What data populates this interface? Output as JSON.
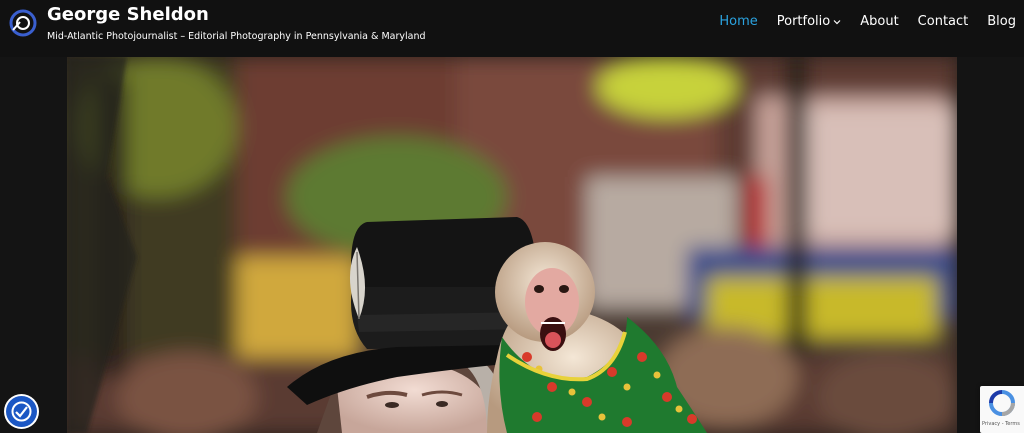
{
  "header": {
    "site_title": "George Sheldon",
    "tagline": "Mid-Atlantic Photojournalist – Editorial Photography in Pennsylvania & Maryland",
    "logo_icon": "camera-swirl-logo-icon"
  },
  "nav": {
    "items": [
      {
        "label": "Home",
        "active": true
      },
      {
        "label": "Portfolio",
        "has_dropdown": true
      },
      {
        "label": "About"
      },
      {
        "label": "Contact"
      },
      {
        "label": "Blog"
      }
    ]
  },
  "hero": {
    "alt_subject": "Man in black top hat with capuchin monkey on shoulder"
  },
  "widgets": {
    "accessibility_icon": "accessibility-icon",
    "recaptcha_links": "Privacy - Terms"
  },
  "colors": {
    "header_bg": "#111111",
    "page_bg": "#141414",
    "nav_active": "#2ba3e0",
    "nav_text": "#ffffff",
    "accessibility_bg": "#1b57c4"
  }
}
